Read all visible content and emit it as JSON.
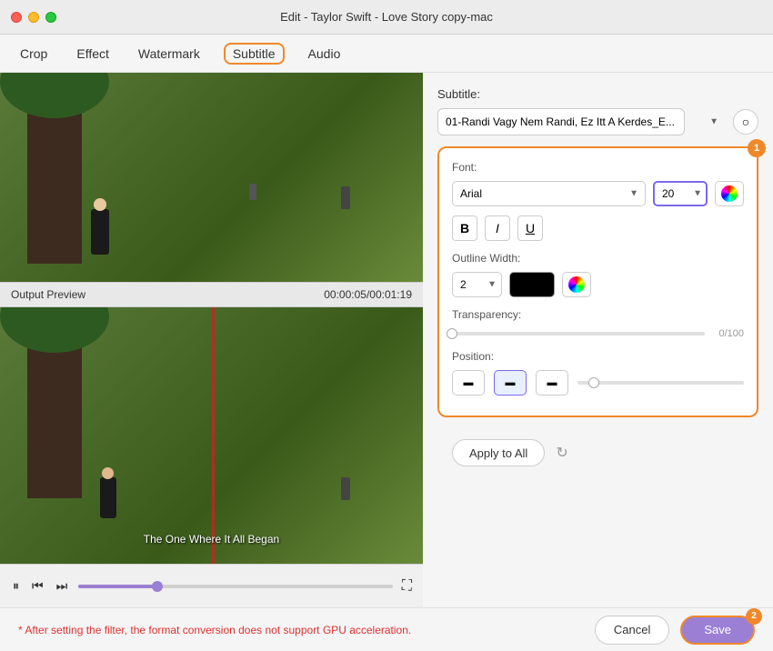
{
  "window": {
    "title": "Edit - Taylor Swift - Love Story copy-mac"
  },
  "nav": {
    "tabs": [
      {
        "id": "crop",
        "label": "Crop"
      },
      {
        "id": "effect",
        "label": "Effect"
      },
      {
        "id": "watermark",
        "label": "Watermark"
      },
      {
        "id": "subtitle",
        "label": "Subtitle",
        "active": true
      },
      {
        "id": "audio",
        "label": "Audio"
      }
    ]
  },
  "subtitle_panel": {
    "label": "Subtitle:",
    "selected_value": "01-Randi Vagy Nem Randi, Ez Itt A Kerdes_E...",
    "search_icon": "🔍",
    "font_card_badge": "1",
    "font": {
      "label": "Font:",
      "family": "Arial",
      "size": "20",
      "bold": "B",
      "italic": "I",
      "underline": "U"
    },
    "outline": {
      "label": "Outline Width:",
      "width": "2",
      "color": "black"
    },
    "transparency": {
      "label": "Transparency:",
      "value": "0/100"
    },
    "position": {
      "label": "Position:",
      "buttons": [
        {
          "id": "pos-left",
          "icon": "⬛"
        },
        {
          "id": "pos-center",
          "icon": "⬛"
        },
        {
          "id": "pos-right",
          "icon": "⬛"
        }
      ]
    }
  },
  "apply_row": {
    "apply_to_all_label": "Apply to All",
    "refresh_icon": "↻"
  },
  "output_preview": {
    "label": "Output Preview",
    "time": "00:00:05/00:01:19"
  },
  "subtitle_overlay": "The One Where It All Began",
  "footer": {
    "warning": "* After setting the filter, the format conversion does not support GPU acceleration.",
    "cancel_label": "Cancel",
    "save_label": "Save",
    "save_badge": "2"
  }
}
